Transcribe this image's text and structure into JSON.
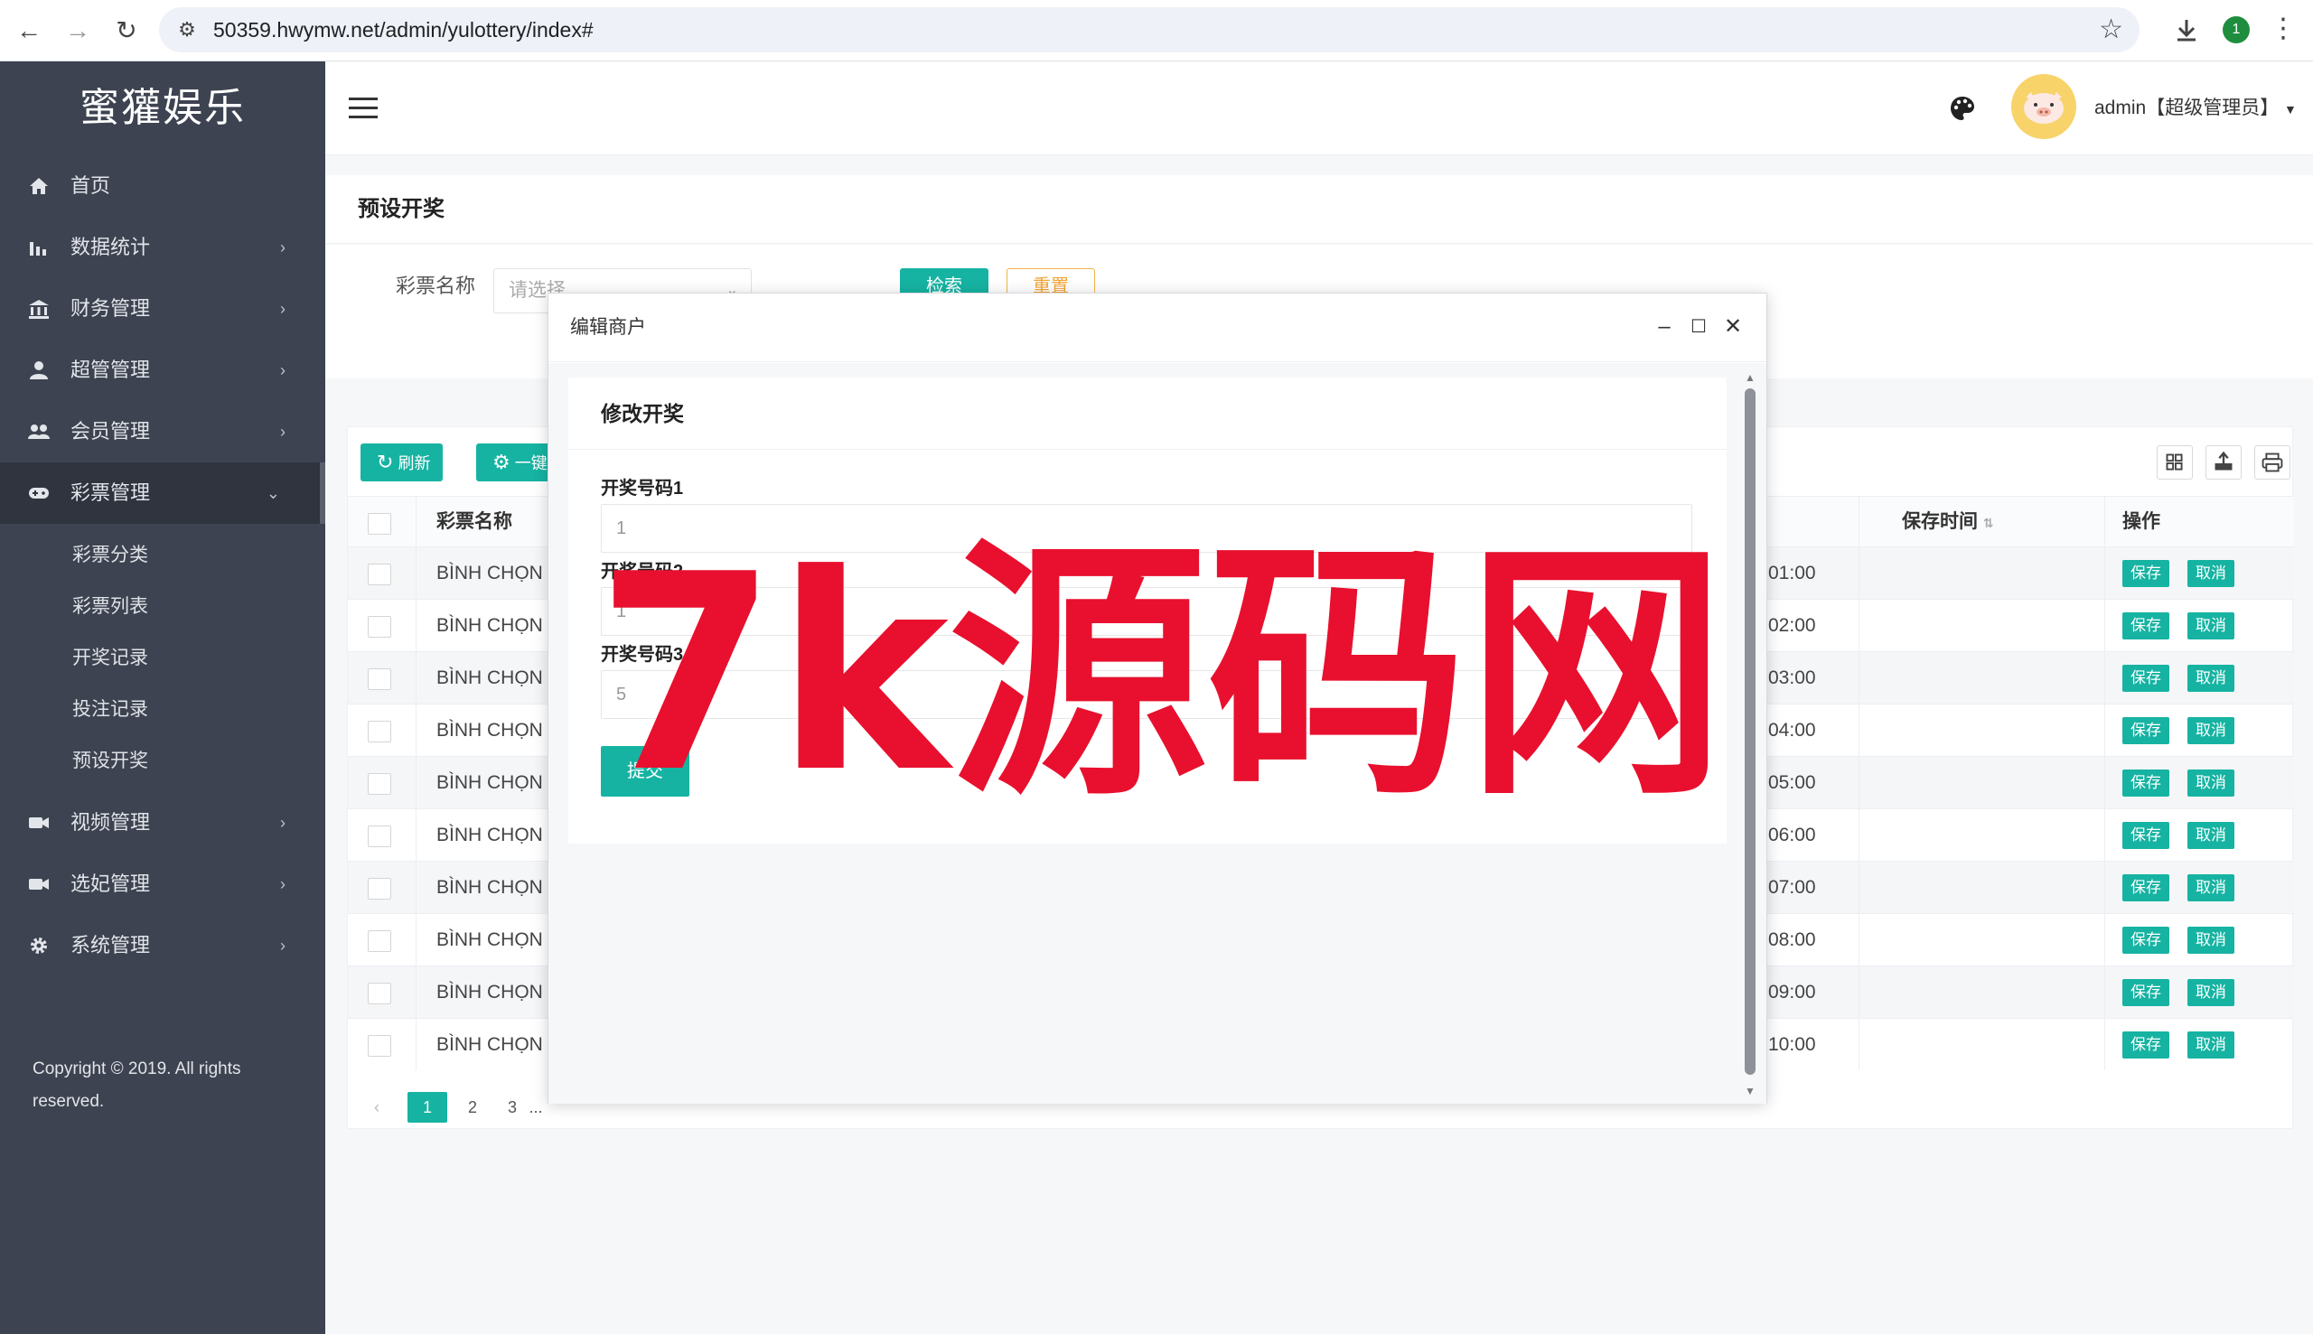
{
  "browser": {
    "url": "50359.hwymw.net/admin/yulottery/index#",
    "profile_initial": "1"
  },
  "sidebar": {
    "brand": "蜜獾娱乐",
    "items": [
      {
        "label": "首页",
        "icon": "home-icon"
      },
      {
        "label": "数据统计",
        "icon": "bar-chart-icon"
      },
      {
        "label": "财务管理",
        "icon": "bank-icon"
      },
      {
        "label": "超管管理",
        "icon": "user-icon"
      },
      {
        "label": "会员管理",
        "icon": "users-icon"
      },
      {
        "label": "彩票管理",
        "icon": "gamepad-icon"
      },
      {
        "label": "视频管理",
        "icon": "video-icon"
      },
      {
        "label": "选妃管理",
        "icon": "video-icon"
      },
      {
        "label": "系统管理",
        "icon": "gear-icon"
      }
    ],
    "lottery_sub": [
      "彩票分类",
      "彩票列表",
      "开奖记录",
      "投注记录",
      "预设开奖"
    ],
    "copyright": "Copyright © 2019. All rights reserved."
  },
  "header": {
    "user": "admin【超级管理员】"
  },
  "page": {
    "title": "预设开奖",
    "search": {
      "label": "彩票名称",
      "placeholder": "请选择",
      "search_btn": "检索",
      "reset_btn": "重置"
    },
    "toolbar": {
      "refresh": "刷新",
      "batch": "一键"
    },
    "table": {
      "headers": {
        "name": "彩票名称",
        "save_time": "保存时间",
        "op": "操作"
      },
      "rows": [
        {
          "name": "BÌNH CHỌN",
          "time": "01:00"
        },
        {
          "name": "BÌNH CHỌN",
          "time": "02:00"
        },
        {
          "name": "BÌNH CHỌN",
          "time": "03:00"
        },
        {
          "name": "BÌNH CHỌN",
          "time": "04:00"
        },
        {
          "name": "BÌNH CHỌN",
          "time": "05:00"
        },
        {
          "name": "BÌNH CHỌN",
          "time": "06:00"
        },
        {
          "name": "BÌNH CHỌN",
          "time": "07:00"
        },
        {
          "name": "BÌNH CHỌN",
          "time": "08:00"
        },
        {
          "name": "BÌNH CHỌN",
          "time": "09:00"
        },
        {
          "name": "BÌNH CHỌN",
          "time": "10:00"
        }
      ],
      "save_btn": "保存",
      "cancel_btn": "取消"
    },
    "pager": {
      "prev": "‹",
      "pages": [
        "1",
        "2",
        "3"
      ],
      "ellipsis": "..."
    }
  },
  "modal": {
    "title": "编辑商户",
    "form_title": "修改开奖",
    "fields": [
      {
        "label": "开奖号码1",
        "value": "1"
      },
      {
        "label": "开奖号码2",
        "value": "1"
      },
      {
        "label": "开奖号码3",
        "value": "5"
      }
    ],
    "submit": "提交"
  },
  "watermark": {
    "text": "7k源码网",
    "color": "#e8102e"
  },
  "colors": {
    "accent": "#16b3a2",
    "sidebar": "#3d4350",
    "reset": "#f3a436"
  }
}
